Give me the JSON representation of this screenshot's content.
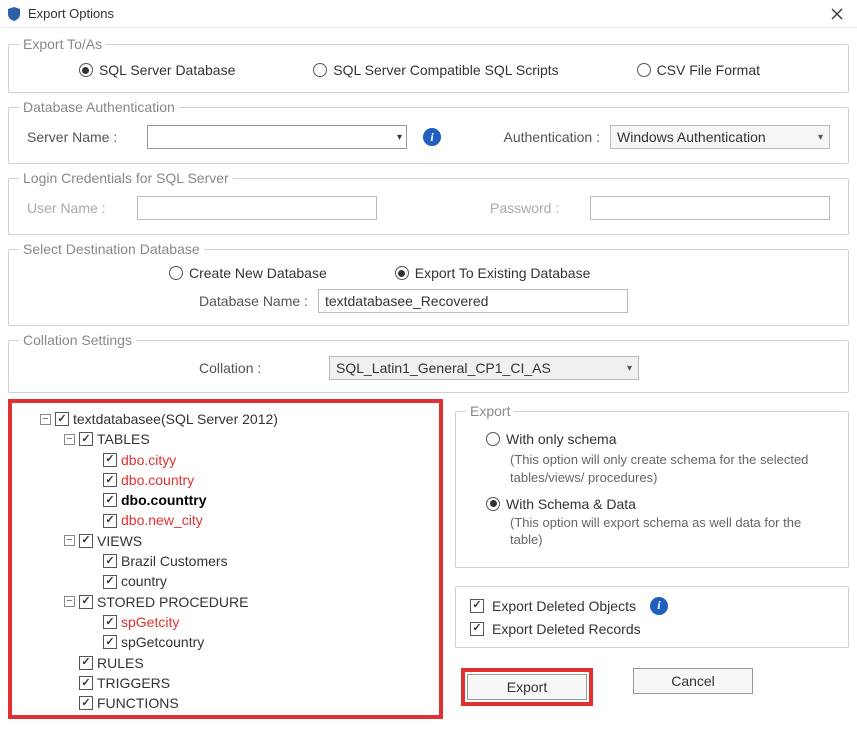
{
  "title": "Export Options",
  "exportToAs": {
    "legend": "Export To/As",
    "options": {
      "sqlDb": "SQL Server Database",
      "sqlScripts": "SQL Server Compatible SQL Scripts",
      "csv": "CSV File Format"
    },
    "selected": "sqlDb"
  },
  "dbAuth": {
    "legend": "Database Authentication",
    "serverNameLabel": "Server Name :",
    "serverNameValue": "",
    "authLabel": "Authentication :",
    "authValue": "Windows Authentication"
  },
  "login": {
    "legend": "Login Credentials for SQL Server",
    "userLabel": "User Name :",
    "userValue": "",
    "passLabel": "Password :",
    "passValue": ""
  },
  "destDb": {
    "legend": "Select Destination Database",
    "createNew": "Create New Database",
    "exportExisting": "Export To Existing Database",
    "selected": "exportExisting",
    "dbNameLabel": "Database Name :",
    "dbNameValue": "textdatabasee_Recovered"
  },
  "collation": {
    "legend": "Collation Settings",
    "label": "Collation :",
    "value": "SQL_Latin1_General_CP1_CI_AS"
  },
  "tree": {
    "root": "textdatabasee(SQL Server 2012)",
    "tablesLabel": "TABLES",
    "tables": [
      "dbo.cityy",
      "dbo.country",
      "dbo.counttry",
      "dbo.new_city"
    ],
    "viewsLabel": "VIEWS",
    "views": [
      "Brazil Customers",
      "country"
    ],
    "spLabel": "STORED PROCEDURE",
    "sps": [
      "spGetcity",
      "spGetcountry"
    ],
    "rulesLabel": "RULES",
    "triggersLabel": "TRIGGERS",
    "functionsLabel": "FUNCTIONS"
  },
  "export": {
    "legend": "Export",
    "schemaOnly": "With only schema",
    "schemaOnlyDesc": "(This option will only create schema for the  selected tables/views/ procedures)",
    "schemaData": "With Schema & Data",
    "schemaDataDesc": "(This option will export schema as well data for the table)",
    "selected": "schemaData",
    "delObjects": "Export Deleted Objects",
    "delRecords": "Export Deleted Records"
  },
  "buttons": {
    "export": "Export",
    "cancel": "Cancel"
  }
}
